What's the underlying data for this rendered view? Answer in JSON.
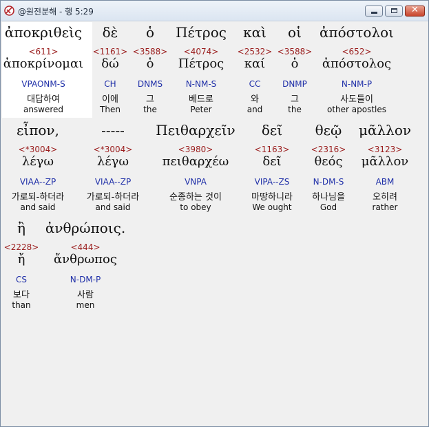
{
  "window": {
    "title": "@원전분해 - 행 5:29",
    "close_glyph": "✕"
  },
  "colors": {
    "strong_number": "#9a1c1c",
    "parsing_code": "#1f2fa8",
    "selected_background": "#ffffff"
  },
  "rows": [
    {
      "words": [
        {
          "greek": "ἀποκριθεὶς",
          "strong": "<611>",
          "lemma": "ἀποκρίνομαι",
          "parse": "VPAONM-S",
          "korean": "대답하여",
          "english": "answered"
        },
        {
          "greek": "δὲ",
          "strong": "<1161>",
          "lemma": "δώ",
          "parse": "CH",
          "korean": "이에",
          "english": "Then"
        },
        {
          "greek": "ὁ",
          "strong": "<3588>",
          "lemma": "ὁ",
          "parse": "DNMS",
          "korean": "그",
          "english": "the"
        },
        {
          "greek": "Πέτρος",
          "strong": "<4074>",
          "lemma": "Πέτρος",
          "parse": "N-NM-S",
          "korean": "베드로",
          "english": "Peter"
        },
        {
          "greek": "καὶ",
          "strong": "<2532>",
          "lemma": "καί",
          "parse": "CC",
          "korean": "와",
          "english": "and"
        },
        {
          "greek": "οἱ",
          "strong": "<3588>",
          "lemma": "ὁ",
          "parse": "DNMP",
          "korean": "그",
          "english": "the"
        },
        {
          "greek": "ἀπόστολοι",
          "strong": "<652>",
          "lemma": "ἀπόστολος",
          "parse": "N-NM-P",
          "korean": "사도들이",
          "english": "other apostles"
        }
      ]
    },
    {
      "words": [
        {
          "greek": "εἶπον,",
          "strong": "<*3004>",
          "lemma": "λέγω",
          "parse": "VIAA--ZP",
          "korean": "가로되-하더라",
          "english": "and said"
        },
        {
          "greek": "-----",
          "strong": "<*3004>",
          "lemma": "λέγω",
          "parse": "VIAA--ZP",
          "korean": "가로되-하더라",
          "english": "and said"
        },
        {
          "greek": "Πειθαρχεῖν",
          "strong": "<3980>",
          "lemma": "πειθαρχέω",
          "parse": "VNPA",
          "korean": "순종하는 것이",
          "english": "to obey"
        },
        {
          "greek": "δεῖ",
          "strong": "<1163>",
          "lemma": "δεῖ",
          "parse": "VIPA--ZS",
          "korean": "마땅하니라",
          "english": "We ought"
        },
        {
          "greek": "θεῷ",
          "strong": "<2316>",
          "lemma": "θεός",
          "parse": "N-DM-S",
          "korean": "하나님을",
          "english": "God"
        },
        {
          "greek": "μᾶλλον",
          "strong": "<3123>",
          "lemma": "μᾶλλον",
          "parse": "ABM",
          "korean": "오히려",
          "english": "rather"
        }
      ]
    },
    {
      "words": [
        {
          "greek": "ἢ",
          "strong": "<2228>",
          "lemma": "ἤ",
          "parse": "CS",
          "korean": "보다",
          "english": "than"
        },
        {
          "greek": "ἀνθρώποις.",
          "strong": "<444>",
          "lemma": "ἄνθρωπος",
          "parse": "N-DM-P",
          "korean": "사람",
          "english": "men"
        }
      ]
    }
  ]
}
